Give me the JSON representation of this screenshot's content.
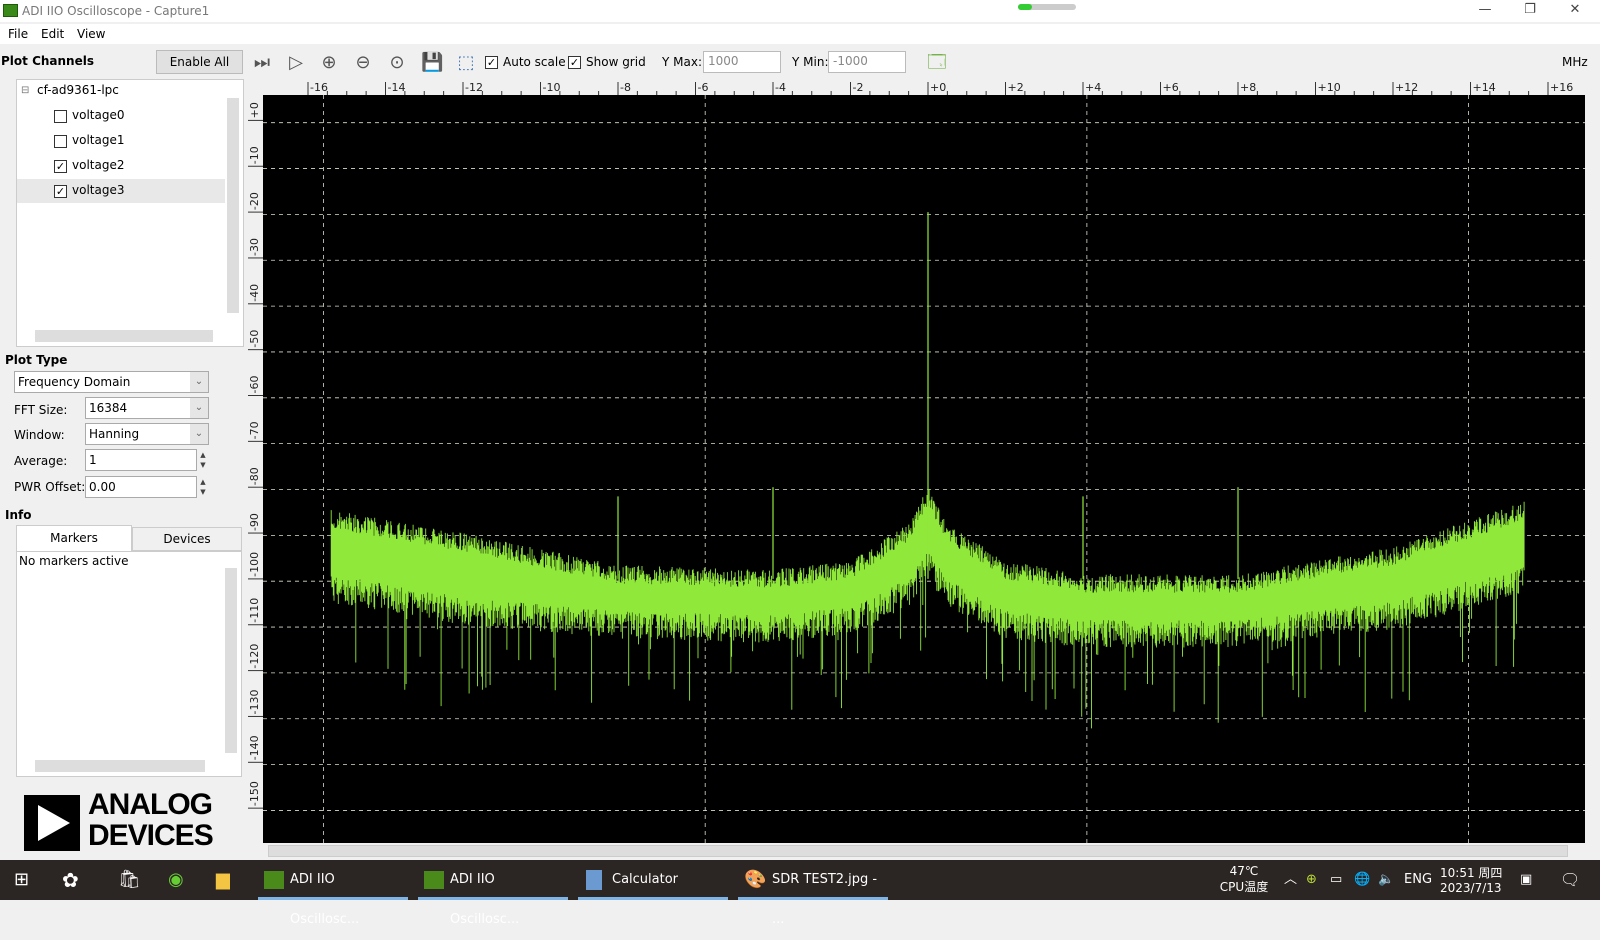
{
  "window": {
    "title": "ADI IIO Oscilloscope - Capture1",
    "minimize": "—",
    "maximize": "❐",
    "close": "✕"
  },
  "menu": [
    "File",
    "Edit",
    "View"
  ],
  "left": {
    "plot_channels_title": "Plot Channels",
    "enable_all": "Enable All",
    "device": "cf-ad9361-lpc",
    "channels": [
      {
        "label": "voltage0",
        "checked": false
      },
      {
        "label": "voltage1",
        "checked": false
      },
      {
        "label": "voltage2",
        "checked": true
      },
      {
        "label": "voltage3",
        "checked": true
      }
    ],
    "plot_type_title": "Plot Type",
    "plot_type": "Frequency Domain",
    "fft_label": "FFT Size:",
    "fft_value": "16384",
    "window_label": "Window:",
    "window_value": "Hanning",
    "average_label": "Average:",
    "average_value": "1",
    "pwr_label": "PWR Offset:",
    "pwr_value": "0.00",
    "info_title": "Info",
    "tabs": [
      "Markers",
      "Devices"
    ],
    "markers_text": "No markers active",
    "logo_line1": "ANALOG",
    "logo_line2": "DEVICES"
  },
  "toolbar": {
    "auto_scale": "Auto scale",
    "auto_scale_checked": true,
    "show_grid": "Show grid",
    "show_grid_checked": true,
    "ymax_label": "Y Max:",
    "ymax": "1000",
    "ymin_label": "Y Min:",
    "ymin": "-1000",
    "unit": "MHz"
  },
  "chart_data": {
    "type": "line",
    "series": [
      {
        "name": "voltage3",
        "color": "#8fe83a"
      }
    ],
    "xlim": [
      -16.5,
      16.5
    ],
    "ylim": [
      -155,
      5
    ],
    "x_ticks": [
      "-16",
      "-14",
      "-12",
      "-10",
      "-8",
      "-6",
      "-4",
      "-2",
      "+0",
      "+2",
      "+4",
      "+6",
      "+8",
      "+10",
      "+12",
      "+14",
      "+16"
    ],
    "y_ticks": [
      "+0",
      "-10",
      "-20",
      "-30",
      "-40",
      "-50",
      "-60",
      "-70",
      "-80",
      "-90",
      "-100",
      "-110",
      "-120",
      "-130",
      "-140",
      "-150"
    ],
    "grid": true,
    "noise_envelope_mhz_top_bottom_db": [
      [
        -15.4,
        -85,
        -105
      ],
      [
        -12,
        -90,
        -110
      ],
      [
        -8,
        -97,
        -113
      ],
      [
        -4,
        -98,
        -114
      ],
      [
        -2,
        -96,
        -112
      ],
      [
        -0.5,
        -88,
        -106
      ],
      [
        0,
        -80,
        -100
      ],
      [
        0.5,
        -88,
        -106
      ],
      [
        2,
        -96,
        -113
      ],
      [
        4,
        -99,
        -115
      ],
      [
        8,
        -99,
        -115
      ],
      [
        12,
        -93,
        -111
      ],
      [
        15.4,
        -83,
        -103
      ]
    ],
    "spurs_mhz_db": [
      [
        0,
        -20
      ],
      [
        -8,
        -82
      ],
      [
        -4,
        -80
      ],
      [
        4,
        -82
      ],
      [
        8,
        -80
      ]
    ]
  },
  "taskbar": {
    "apps": [
      "ADI IIO Oscillosc...",
      "ADI IIO Oscillosc...",
      "Calculator",
      "SDR TEST2.jpg - ..."
    ],
    "temp": "47℃",
    "temp_label": "CPU温度",
    "lang": "ENG",
    "time": "10:51 周四",
    "date": "2023/7/13"
  }
}
